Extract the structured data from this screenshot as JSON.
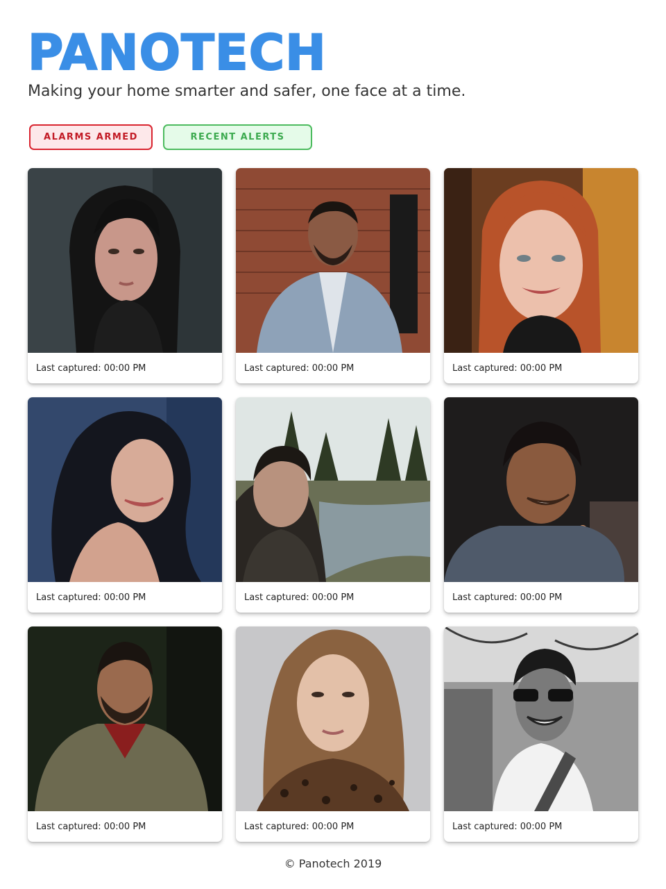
{
  "header": {
    "brand": "PANOTECH",
    "tagline": "Making your home smarter and safer, one face at a time."
  },
  "actions": {
    "alarms_armed_label": "ALARMS ARMED",
    "recent_alerts_label": "RECENT ALERTS"
  },
  "colors": {
    "brand": "#3a8ee6",
    "armed_border": "#d9242f",
    "armed_bg": "#fde8ea",
    "alerts_border": "#4cbb5e",
    "alerts_bg": "#e5fbe9"
  },
  "faces": [
    {
      "caption": "Last captured: 00:00 PM"
    },
    {
      "caption": "Last captured: 00:00 PM"
    },
    {
      "caption": "Last captured: 00:00 PM"
    },
    {
      "caption": "Last captured: 00:00 PM"
    },
    {
      "caption": "Last captured: 00:00 PM"
    },
    {
      "caption": "Last captured: 00:00 PM"
    },
    {
      "caption": "Last captured: 00:00 PM"
    },
    {
      "caption": "Last captured: 00:00 PM"
    },
    {
      "caption": "Last captured: 00:00 PM"
    }
  ],
  "footer": {
    "copyright": "© Panotech 2019"
  }
}
